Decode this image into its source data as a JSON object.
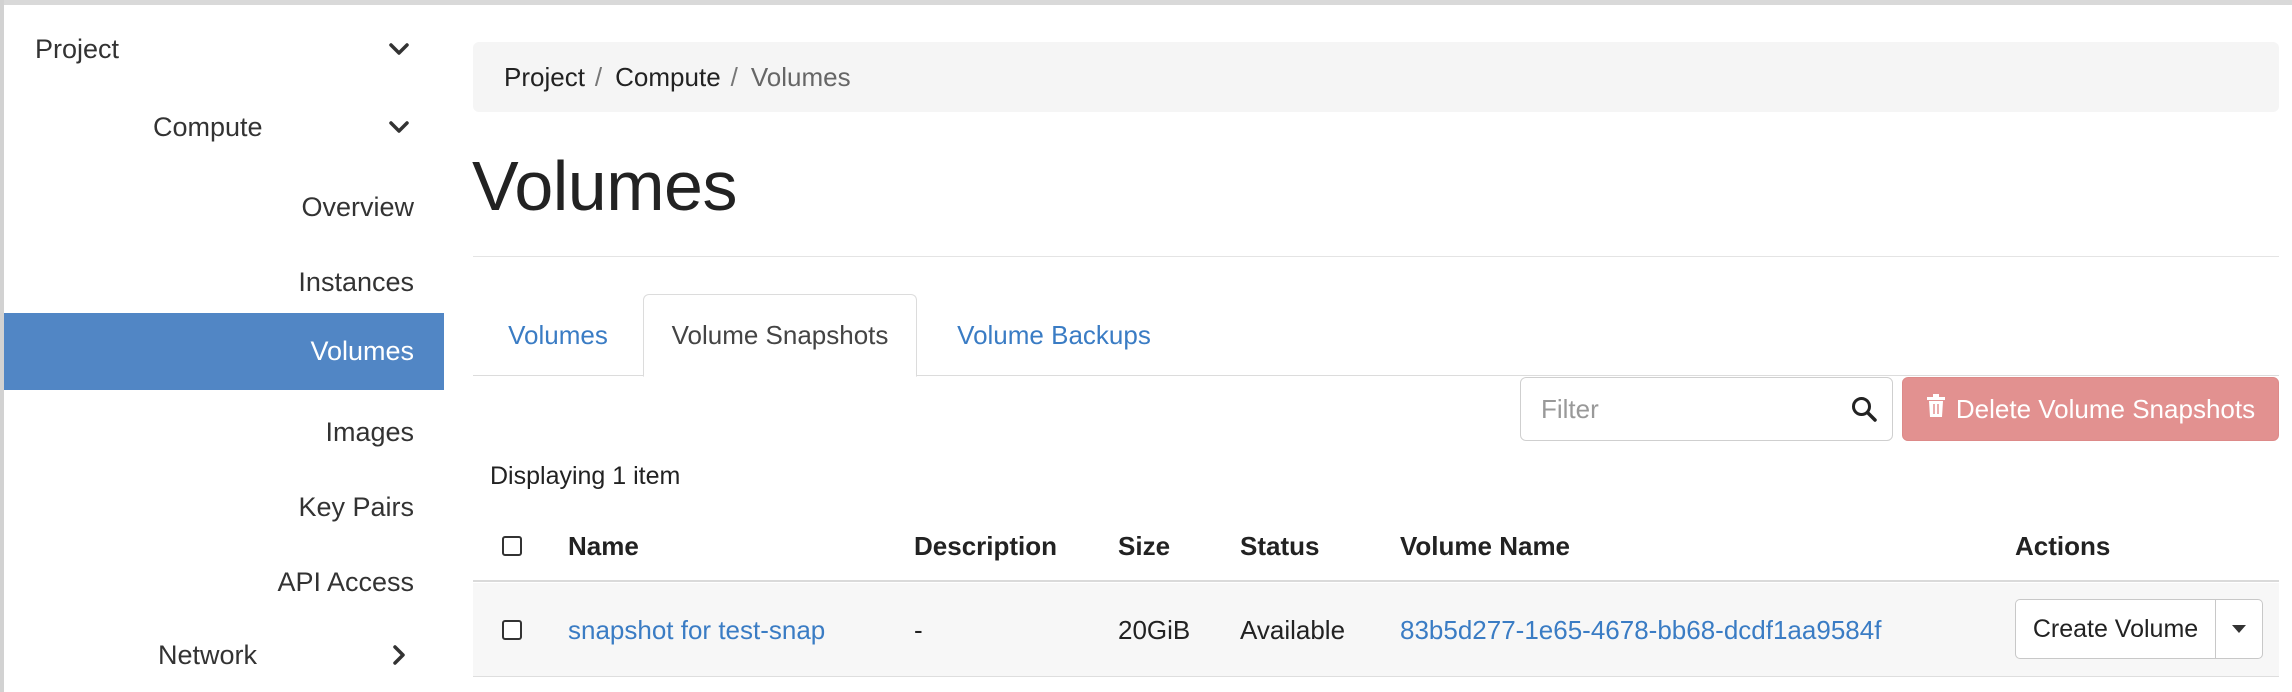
{
  "sidebar": {
    "project_label": "Project",
    "compute_label": "Compute",
    "items": [
      {
        "label": "Overview",
        "active": false
      },
      {
        "label": "Instances",
        "active": false
      },
      {
        "label": "Volumes",
        "active": true
      },
      {
        "label": "Images",
        "active": false
      },
      {
        "label": "Key Pairs",
        "active": false
      },
      {
        "label": "API Access",
        "active": false
      }
    ],
    "network_label": "Network",
    "active_color": "#5186c5"
  },
  "breadcrumb": [
    "Project",
    "Compute",
    "Volumes"
  ],
  "page_title": "Volumes",
  "tabs": [
    {
      "label": "Volumes",
      "active": false
    },
    {
      "label": "Volume Snapshots",
      "active": true
    },
    {
      "label": "Volume Backups",
      "active": false
    }
  ],
  "filter": {
    "placeholder": "Filter",
    "value": ""
  },
  "delete_button": {
    "label": "Delete Volume Snapshots",
    "color": "#e29190"
  },
  "count_text": "Displaying 1 item",
  "table": {
    "columns": [
      "Name",
      "Description",
      "Size",
      "Status",
      "Volume Name",
      "Actions"
    ],
    "rows": [
      {
        "name": "snapshot for test-snap",
        "description": "-",
        "size": "20GiB",
        "status": "Available",
        "volume_name": "83b5d277-1e65-4678-bb68-dcdf1aa9584f",
        "action": "Create Volume"
      }
    ]
  },
  "link_color": "#3a7cc4",
  "icons": {
    "chevron": "chevron-down-icon",
    "chevron_right": "chevron-right-icon",
    "search": "search-icon",
    "trash": "trash-icon",
    "caret": "caret-down-icon"
  }
}
